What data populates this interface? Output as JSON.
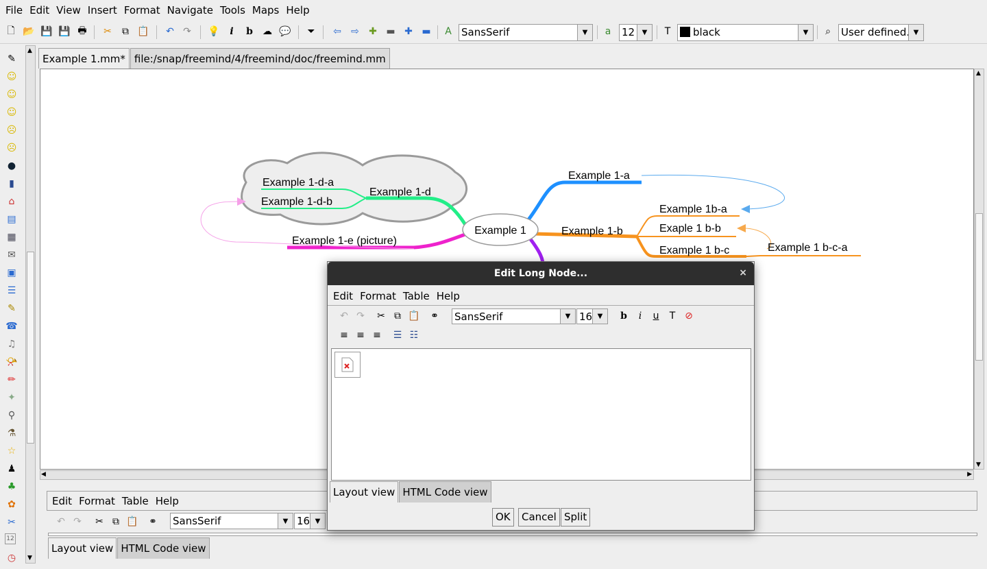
{
  "menubar": {
    "items": [
      "File",
      "Edit",
      "View",
      "Insert",
      "Format",
      "Navigate",
      "Tools",
      "Maps",
      "Help"
    ]
  },
  "toolbar": {
    "font_family": "SansSerif",
    "font_size": "12",
    "color_name": "black",
    "color_value": "#000000",
    "style": "User defined."
  },
  "tabs": [
    "Example 1.mm*",
    "file:/snap/freemind/4/freemind/doc/freemind.mm"
  ],
  "mindmap": {
    "root": "Example 1",
    "nodes": {
      "a": "Example 1-a",
      "b": "Example 1-b",
      "b_a": "Example 1b-a",
      "b_b": "Exaple 1 b-b",
      "b_c": "Example 1 b-c",
      "b_c_a": "Example 1 b-c-a",
      "d": "Example 1-d",
      "d_a": "Example 1-d-a",
      "d_b": "Example 1-d-b",
      "e": "Example 1-e (picture)"
    },
    "colors": {
      "a": "#1e90ff",
      "b": "#f7931e",
      "d": "#22ee88",
      "e": "#ee22cc",
      "c": "#a020f0",
      "cloud": "#999999",
      "arrow_a": "#5aaaee",
      "arrow_b": "#f7a94c",
      "arrow_e": "#f5a0e8"
    }
  },
  "notes_panel": {
    "menu": [
      "Edit",
      "Format",
      "Table",
      "Help"
    ],
    "font_family": "SansSerif",
    "font_size": "16",
    "view_tabs": [
      "Layout view",
      "HTML Code view"
    ]
  },
  "dialog": {
    "title": "Edit Long Node...",
    "close": "×",
    "menu": [
      "Edit",
      "Format",
      "Table",
      "Help"
    ],
    "font_family": "SansSerif",
    "font_size": "16",
    "view_tabs": [
      "Layout view",
      "HTML Code view"
    ],
    "buttons": [
      "OK",
      "Cancel",
      "Split"
    ]
  }
}
